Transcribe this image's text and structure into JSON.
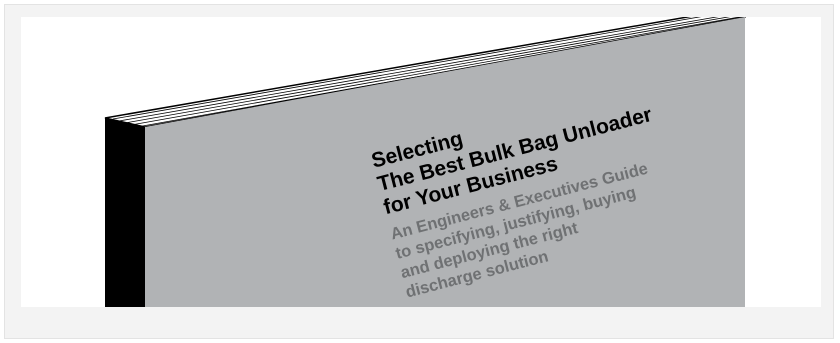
{
  "book": {
    "title_line1": "Selecting",
    "title_line2": "The Best Bulk Bag Unloader",
    "title_line3": "for Your Business",
    "subtitle_line1": "An Engineers & Executives Guide",
    "subtitle_line2": "to specifying, justifying, buying",
    "subtitle_line3": "and deploying the right",
    "subtitle_line4": "discharge solution"
  },
  "colors": {
    "cover": "#b1b3b5",
    "spine": "#000000",
    "title_text": "#000000",
    "subtitle_text": "#6f7173",
    "card_background": "#f3f3f3"
  }
}
